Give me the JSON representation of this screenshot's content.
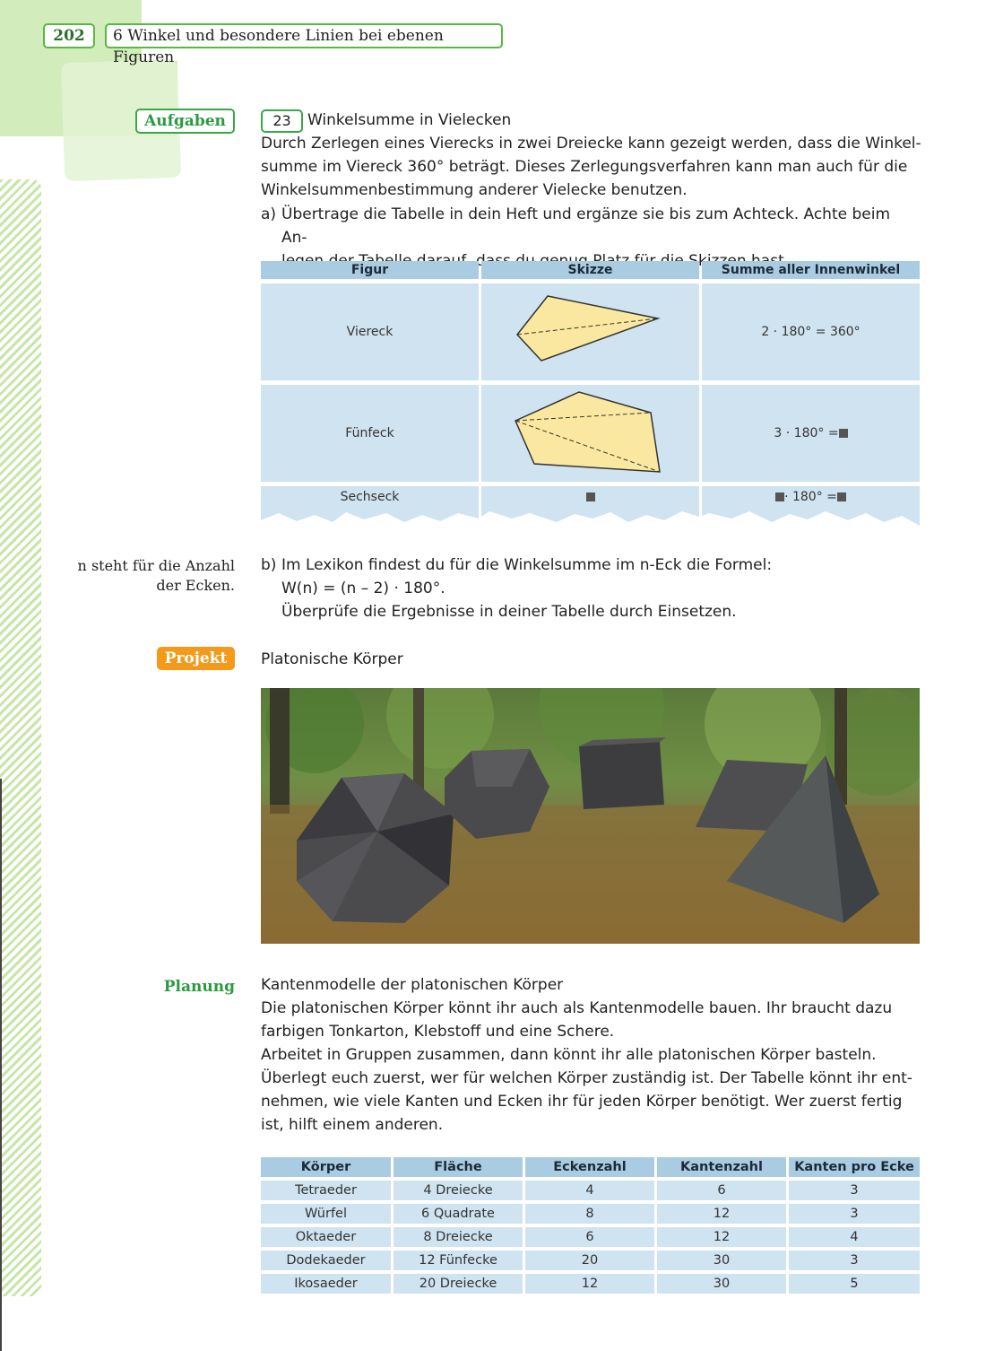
{
  "header": {
    "page_number": "202",
    "chapter": "6  Winkel und besondere Linien bei ebenen Figuren"
  },
  "aufgaben": {
    "label": "Aufgaben",
    "task_number": "23",
    "task_title": "Winkelsumme in Vielecken",
    "intro": [
      "Durch Zerlegen eines Vierecks in zwei Dreiecke kann gezeigt werden, dass die Winkel-",
      "summe im Viereck 360° beträgt. Dieses Zerlegungsverfahren kann man auch für die",
      "Winkelsummenbestimmung anderer Vielecke benutzen."
    ],
    "part_a_label": "a)",
    "part_a": [
      "Übertrage die Tabelle in dein Heft und ergänze sie bis zum Achteck. Achte beim An-",
      "legen der Tabelle darauf, dass du genug Platz für die Skizzen hast."
    ],
    "table": {
      "headers": [
        "Figur",
        "Skizze",
        "Summe aller Innenwinkel"
      ],
      "rows": [
        {
          "figur": "Viereck",
          "summe": "2 · 180° = 360°"
        },
        {
          "figur": "Fünfeck",
          "summe_prefix": "3 · 180° = "
        },
        {
          "figur": "Sechseck",
          "summe_mid": " · 180° = "
        }
      ]
    },
    "margin_note": [
      "n steht für die Anzahl",
      "der Ecken."
    ],
    "part_b_label": "b)",
    "part_b": [
      "Im Lexikon findest du für die Winkelsumme im n-Eck die Formel:",
      "W(n) = (n – 2) · 180°.",
      "Überprüfe die Ergebnisse in deiner Tabelle durch Einsetzen."
    ]
  },
  "projekt": {
    "label": "Projekt",
    "title": "Platonische Körper"
  },
  "planung": {
    "label": "Planung",
    "title": "Kantenmodelle der platonischen Körper",
    "lines": [
      "Die platonischen Körper könnt ihr auch als Kantenmodelle bauen. Ihr braucht dazu",
      "farbigen Tonkarton, Klebstoff und eine Schere.",
      "Arbeitet in Gruppen zusammen, dann könnt ihr alle platonischen Körper basteln.",
      "Überlegt euch zuerst, wer für welchen Körper zuständig ist. Der Tabelle könnt ihr ent-",
      "nehmen, wie viele Kanten und Ecken ihr für jeden Körper benötigt. Wer zuerst fertig",
      "ist, hilft einem anderen."
    ],
    "table": {
      "headers": [
        "Körper",
        "Fläche",
        "Eckenzahl",
        "Kantenzahl",
        "Kanten pro Ecke"
      ],
      "rows": [
        [
          "Tetraeder",
          "4 Dreiecke",
          "4",
          "6",
          "3"
        ],
        [
          "Würfel",
          "6 Quadrate",
          "8",
          "12",
          "3"
        ],
        [
          "Oktaeder",
          "8 Dreiecke",
          "6",
          "12",
          "4"
        ],
        [
          "Dodekaeder",
          "12 Fünfecke",
          "20",
          "30",
          "3"
        ],
        [
          "Ikosaeder",
          "20 Dreiecke",
          "12",
          "30",
          "5"
        ]
      ]
    }
  },
  "colors": {
    "green_accent": "#3aa64a",
    "orange_accent": "#f39a1a",
    "table_header": "#a9cce3",
    "table_cell": "#cfe3f0",
    "sketch_fill": "#fbe8a0"
  }
}
